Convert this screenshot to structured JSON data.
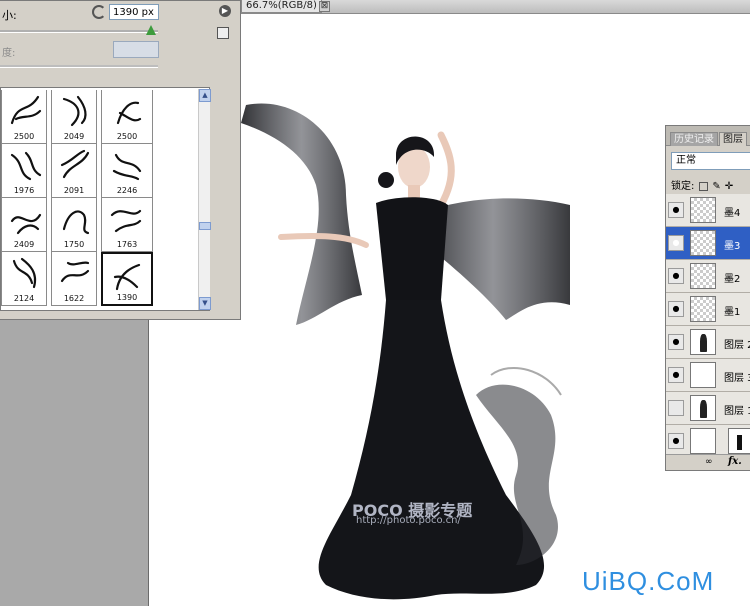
{
  "document": {
    "tab_title": "66.7%(RGB/8)",
    "close_glyph": "⊠"
  },
  "brush_panel": {
    "size_label": "小:",
    "size_value": "1390 px",
    "hardness_label": "度:",
    "menu_glyph": "▶",
    "brushes": [
      {
        "size": "2500"
      },
      {
        "size": "2049"
      },
      {
        "size": "2500"
      },
      {
        "size": "1976"
      },
      {
        "size": "2091"
      },
      {
        "size": "2246"
      },
      {
        "size": "2409"
      },
      {
        "size": "1750"
      },
      {
        "size": "1763"
      },
      {
        "size": "2124"
      },
      {
        "size": "1622"
      },
      {
        "size": "1390",
        "selected": true
      }
    ],
    "scroll_up": "▲",
    "scroll_down": "▼"
  },
  "layers_panel": {
    "tab_history": "历史记录",
    "tab_layers": "图层",
    "blend_mode": "正常",
    "lock_label": "锁定:",
    "layers": [
      {
        "name": "墨4",
        "visible": true,
        "thumb": "transparent"
      },
      {
        "name": "墨3",
        "visible": true,
        "thumb": "transparent",
        "selected": true
      },
      {
        "name": "墨2",
        "visible": true,
        "thumb": "transparent"
      },
      {
        "name": "墨1",
        "visible": true,
        "thumb": "transparent"
      },
      {
        "name": "图层 2",
        "visible": true,
        "thumb": "figure"
      },
      {
        "name": "图层 3",
        "visible": true,
        "thumb": "white"
      },
      {
        "name": "图层 1",
        "visible": false,
        "thumb": "figure"
      },
      {
        "name": "",
        "visible": true,
        "thumb": "adjust"
      }
    ],
    "bottom_link": "∞",
    "bottom_fx": "fx."
  },
  "canvas": {
    "watermark_brand": "POCO 摄影专题",
    "watermark_url": "http://photo.poco.cn/",
    "site_mark": "UiBQ.CoM"
  }
}
